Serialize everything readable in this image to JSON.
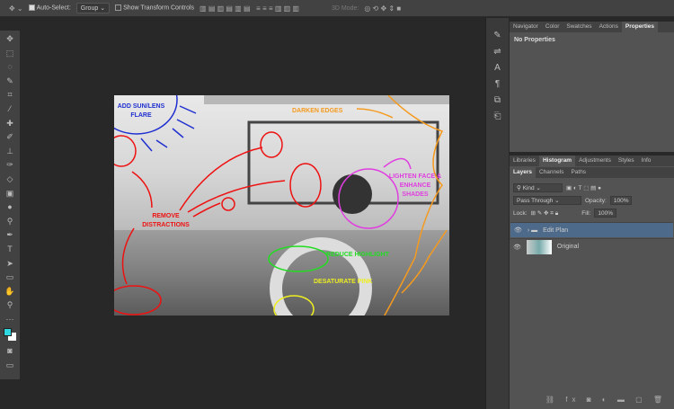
{
  "options_bar": {
    "auto_select_label": "Auto-Select:",
    "auto_select_checked": true,
    "auto_select_value": "Group",
    "show_transform_label": "Show Transform Controls",
    "show_transform_checked": false,
    "mode_3d": "3D Mode:"
  },
  "properties_panel": {
    "tabs": [
      "Navigator",
      "Color",
      "Swatches",
      "Actions",
      "Properties"
    ],
    "active": "Properties",
    "content": "No Properties"
  },
  "histogram_panel": {
    "tabs": [
      "Libraries",
      "Histogram",
      "Adjustments",
      "Styles",
      "Info"
    ],
    "active": "Histogram"
  },
  "layers_panel": {
    "tabs": [
      "Layers",
      "Channels",
      "Paths"
    ],
    "active": "Layers",
    "filter": "Kind",
    "blend_mode": "Pass Through",
    "opacity_label": "Opacity:",
    "opacity": "100%",
    "lock_label": "Lock:",
    "fill_label": "Fill:",
    "fill": "100%",
    "layers": [
      {
        "name": "Edit Plan",
        "type": "group",
        "visible": true,
        "selected": true
      },
      {
        "name": "Original",
        "type": "image",
        "visible": true,
        "selected": false
      }
    ]
  },
  "annotations": {
    "sun": "ADD SUN/LENS FLARE",
    "darken": "DARKEN EDGES",
    "face": "LIGHTEN FACE & ENHANCE SHADES",
    "remove": "REMOVE DISTRACTIONS",
    "highlight": "REDUCE HIGHLIGHT",
    "pink": "DESATURATE PINK"
  },
  "colors": {
    "foreground": "#2fd7e0",
    "background": "#ffffff",
    "selected_layer": "#4e6a8a"
  }
}
